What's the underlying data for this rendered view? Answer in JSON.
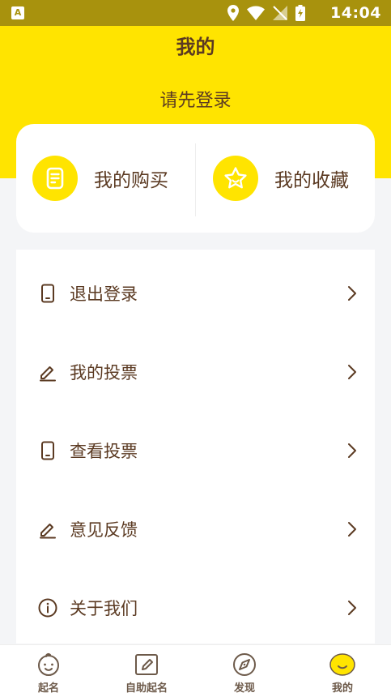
{
  "status_bar": {
    "time": "14:04"
  },
  "header": {
    "title": "我的",
    "login_prompt": "请先登录"
  },
  "quick_actions": [
    {
      "label": "我的购买",
      "icon": "receipt-icon"
    },
    {
      "label": "我的收藏",
      "icon": "star-icon"
    }
  ],
  "menu": [
    {
      "label": "退出登录",
      "icon": "phone-icon"
    },
    {
      "label": "我的投票",
      "icon": "pencil-icon"
    },
    {
      "label": "查看投票",
      "icon": "phone-icon"
    },
    {
      "label": "意见反馈",
      "icon": "pencil-icon"
    },
    {
      "label": "关于我们",
      "icon": "info-icon"
    }
  ],
  "tabs": [
    {
      "label": "起名",
      "icon": "baby-face-icon",
      "active": false
    },
    {
      "label": "自助起名",
      "icon": "edit-box-icon",
      "active": false
    },
    {
      "label": "发现",
      "icon": "compass-icon",
      "active": false
    },
    {
      "label": "我的",
      "icon": "smiley-icon",
      "active": true
    }
  ],
  "colors": {
    "accent": "#ffe400",
    "status_bar": "#a8920d",
    "text": "#5b3a22",
    "background": "#f4f5f7"
  }
}
